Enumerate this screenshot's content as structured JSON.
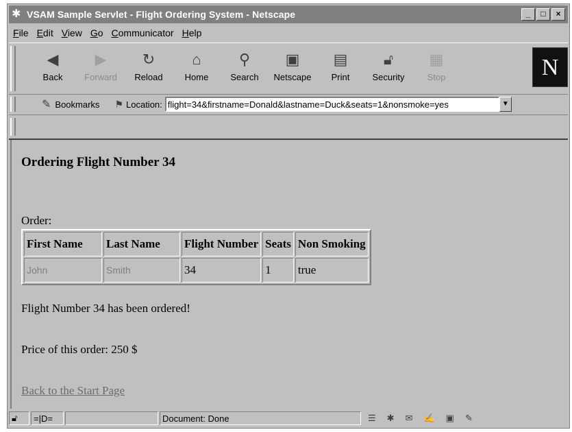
{
  "window": {
    "title": "VSAM Sample Servlet - Flight Ordering System - Netscape",
    "controls": [
      "_",
      "□",
      "×"
    ]
  },
  "menu": [
    "File",
    "Edit",
    "View",
    "Go",
    "Communicator",
    "Help"
  ],
  "toolbar": {
    "buttons": [
      {
        "label": "Back",
        "icon": "back-arrow-icon",
        "enabled": true
      },
      {
        "label": "Forward",
        "icon": "forward-arrow-icon",
        "enabled": false
      },
      {
        "label": "Reload",
        "icon": "reload-icon",
        "enabled": true
      },
      {
        "label": "Home",
        "icon": "home-icon",
        "enabled": true
      },
      {
        "label": "Search",
        "icon": "search-icon",
        "enabled": true
      },
      {
        "label": "Netscape",
        "icon": "my-netscape-icon",
        "enabled": true
      },
      {
        "label": "Print",
        "icon": "print-icon",
        "enabled": true
      },
      {
        "label": "Security",
        "icon": "security-lock-icon",
        "enabled": true
      },
      {
        "label": "Stop",
        "icon": "stop-icon",
        "enabled": false
      }
    ],
    "logo": "N"
  },
  "location": {
    "bookmarks_label": "Bookmarks",
    "location_label": "Location:",
    "url": "flight=34&firstname=Donald&lastname=Duck&seats=1&nonsmoke=yes"
  },
  "page": {
    "heading": "Ordering Flight Number 34",
    "order_label": "Order:",
    "table": {
      "headers": [
        "First Name",
        "Last Name",
        "Flight Number",
        "Seats",
        "Non Smoking"
      ],
      "row": [
        "John",
        "Smith",
        "34",
        "1",
        "true"
      ]
    },
    "message": "Flight Number 34 has been ordered!",
    "price": "Price of this order: 250 $",
    "back_link": "Back to the Start Page"
  },
  "status": {
    "text": "Document: Done"
  }
}
